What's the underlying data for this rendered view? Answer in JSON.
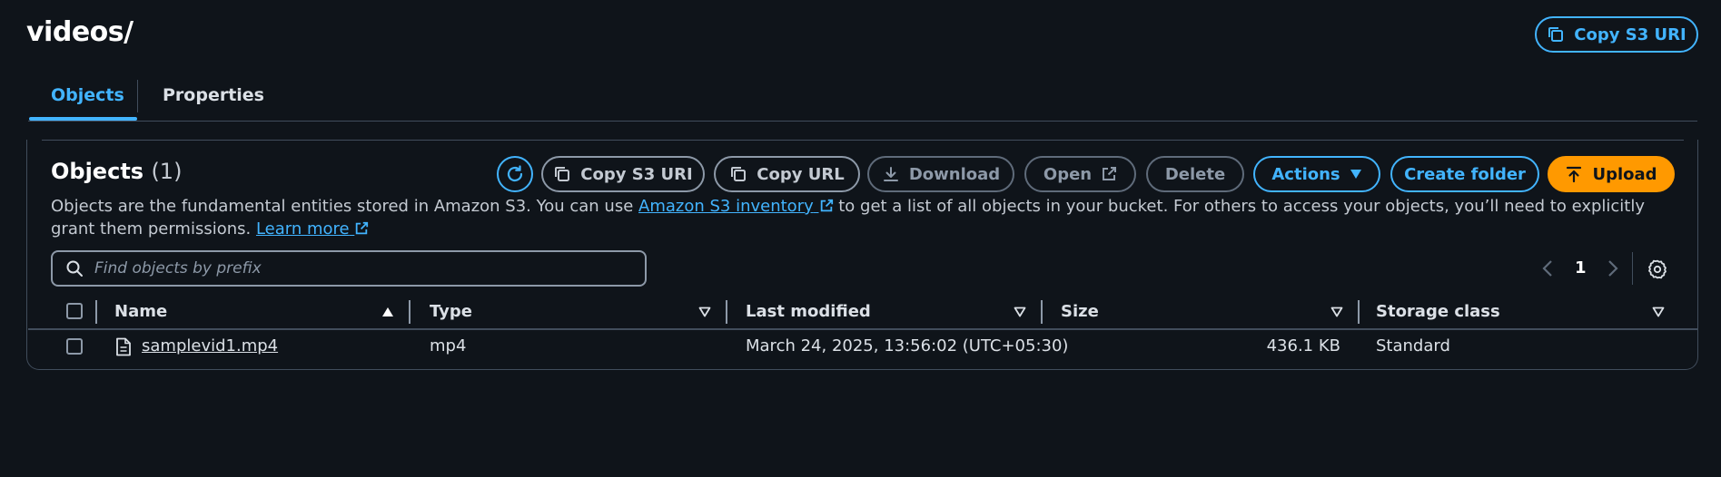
{
  "header": {
    "title": "videos/",
    "copy_s3_uri_label": "Copy S3 URI"
  },
  "tabs": [
    {
      "label": "Objects",
      "active": true
    },
    {
      "label": "Properties",
      "active": false
    }
  ],
  "objects_panel": {
    "title": "Objects",
    "count": "(1)",
    "toolbar": {
      "copy_s3_uri": "Copy S3 URI",
      "copy_url": "Copy URL",
      "download": "Download",
      "open": "Open",
      "delete": "Delete",
      "actions": "Actions",
      "create_folder": "Create folder",
      "upload": "Upload"
    },
    "description": {
      "part1": "Objects are the fundamental entities stored in Amazon S3. You can use ",
      "inventory_link": "Amazon S3 inventory",
      "part2": " to get a list of all objects in your bucket. For others to access your objects, you’ll need to explicitly grant them permissions. ",
      "learn_more_link": "Learn more"
    },
    "search": {
      "placeholder": "Find objects by prefix",
      "value": ""
    },
    "pagination": {
      "current_page": "1"
    },
    "table": {
      "columns": [
        "Name",
        "Type",
        "Last modified",
        "Size",
        "Storage class"
      ],
      "rows": [
        {
          "name": "samplevid1.mp4",
          "type": "mp4",
          "last_modified": "March 24, 2025, 13:56:02 (UTC+05:30)",
          "size": "436.1 KB",
          "storage_class": "Standard"
        }
      ]
    }
  },
  "colors": {
    "background": "#0f141a",
    "accent": "#42b4ff",
    "primary_button": "#ff9900",
    "border": "#414d5c"
  },
  "icons": {
    "copy": "copy-icon",
    "refresh": "refresh-icon",
    "download": "download-icon",
    "external": "external-link-icon",
    "dropdown": "caret-down-icon",
    "upload": "upload-icon",
    "search": "search-icon",
    "settings": "gear-icon",
    "file": "file-icon"
  }
}
